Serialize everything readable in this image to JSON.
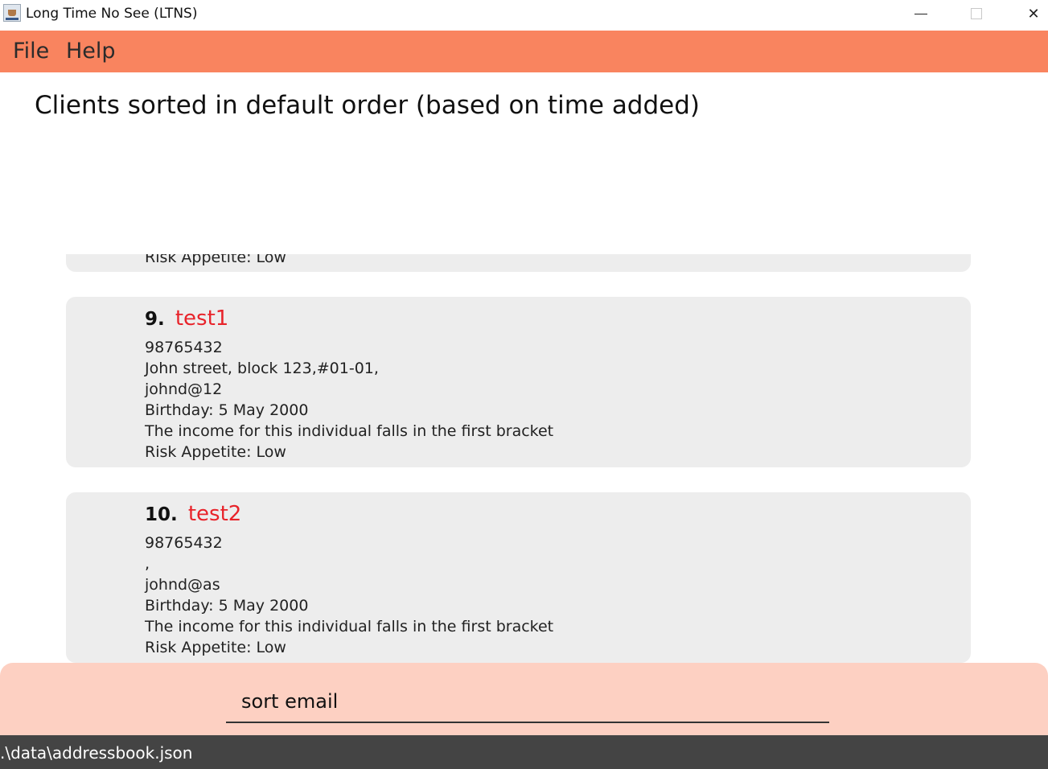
{
  "window": {
    "title": "Long Time No See (LTNS)",
    "controls": {
      "minimize": "",
      "maximize": "",
      "close": "✕"
    }
  },
  "menu": {
    "items": [
      {
        "label": "File"
      },
      {
        "label": "Help"
      }
    ]
  },
  "result_display": {
    "text": "Clients sorted in default order (based on time added)"
  },
  "client_list": {
    "partial_card": {
      "last_line": "Risk Appetite: Low"
    },
    "cards": [
      {
        "index": "9.",
        "name": "test1",
        "phone": "98765432",
        "address": "John street, block 123,#01-01,",
        "email": "johnd@12",
        "birthday": "Birthday: 5 May 2000",
        "income": "The income for this individual falls in the first bracket",
        "risk": "Risk Appetite: Low"
      },
      {
        "index": "10.",
        "name": "test2",
        "phone": "98765432",
        "address": ",",
        "email": "johnd@as",
        "birthday": "Birthday: 5 May 2000",
        "income": "The income for this individual falls in the first bracket",
        "risk": "Risk Appetite: Low"
      }
    ]
  },
  "command_box": {
    "value": "sort email"
  },
  "status_bar": {
    "path": ".\\data\\addressbook.json"
  },
  "colors": {
    "menu_bar": "#f9845f",
    "command_area": "#fdd0c2",
    "card_background": "#ededed",
    "client_name": "#e8232a",
    "status_bar": "#444444"
  },
  "icons": {
    "app": "app-icon",
    "minimize": "minimize-icon",
    "maximize": "maximize-icon",
    "close": "close-icon"
  }
}
